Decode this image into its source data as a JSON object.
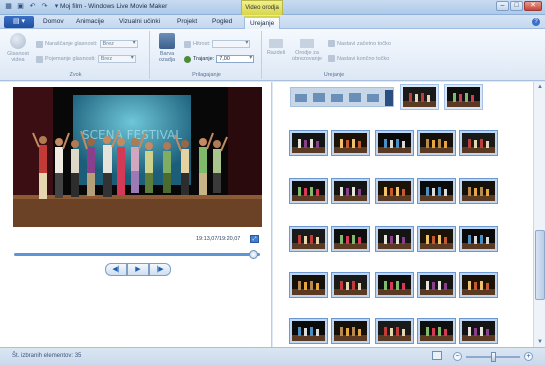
{
  "window": {
    "title": "Moj film - Windows Live Movie Maker",
    "contextual_tab_title": "Video orodja",
    "buttons": [
      "minimize",
      "maximize",
      "close"
    ]
  },
  "tabs": [
    {
      "label": "Domov",
      "active": false
    },
    {
      "label": "Animacije",
      "active": false
    },
    {
      "label": "Vizualni učinki",
      "active": false
    },
    {
      "label": "Projekt",
      "active": false
    },
    {
      "label": "Pogled",
      "active": false
    },
    {
      "label": "Urejanje",
      "active": true
    }
  ],
  "ribbon": {
    "audio_group": {
      "label": "Zvok",
      "volume_button": "Glasnost videa",
      "fade_in_label": "Naraščanje glasnosti:",
      "fade_in_value": "Brez",
      "fade_out_label": "Pojemanje glasnosti:",
      "fade_out_value": "Brez"
    },
    "adjust_group": {
      "label": "Prilagajanje",
      "background_color_button": "Barva ozadja",
      "speed_label": "Hitrost:",
      "speed_value": "",
      "duration_label": "Trajanje:",
      "duration_value": "7,00"
    },
    "editing_group": {
      "label": "Urejanje",
      "split_button": "Razdeli",
      "trim_tool_button": "Orodje za obrezovanje",
      "set_start_button": "Nastavi začetno točko",
      "set_end_button": "Nastavi končno točko"
    }
  },
  "preview": {
    "timecode": "19:13,07/19:20,07",
    "seek_progress": 0.99
  },
  "status": {
    "items_text": "Št. izbranih elementov: 35"
  },
  "zoom": {
    "level": 0.5
  },
  "colors": {
    "accent": "#3b70c6",
    "contextual_tab": "#d6d64c",
    "selection": "#bfd6f2"
  }
}
